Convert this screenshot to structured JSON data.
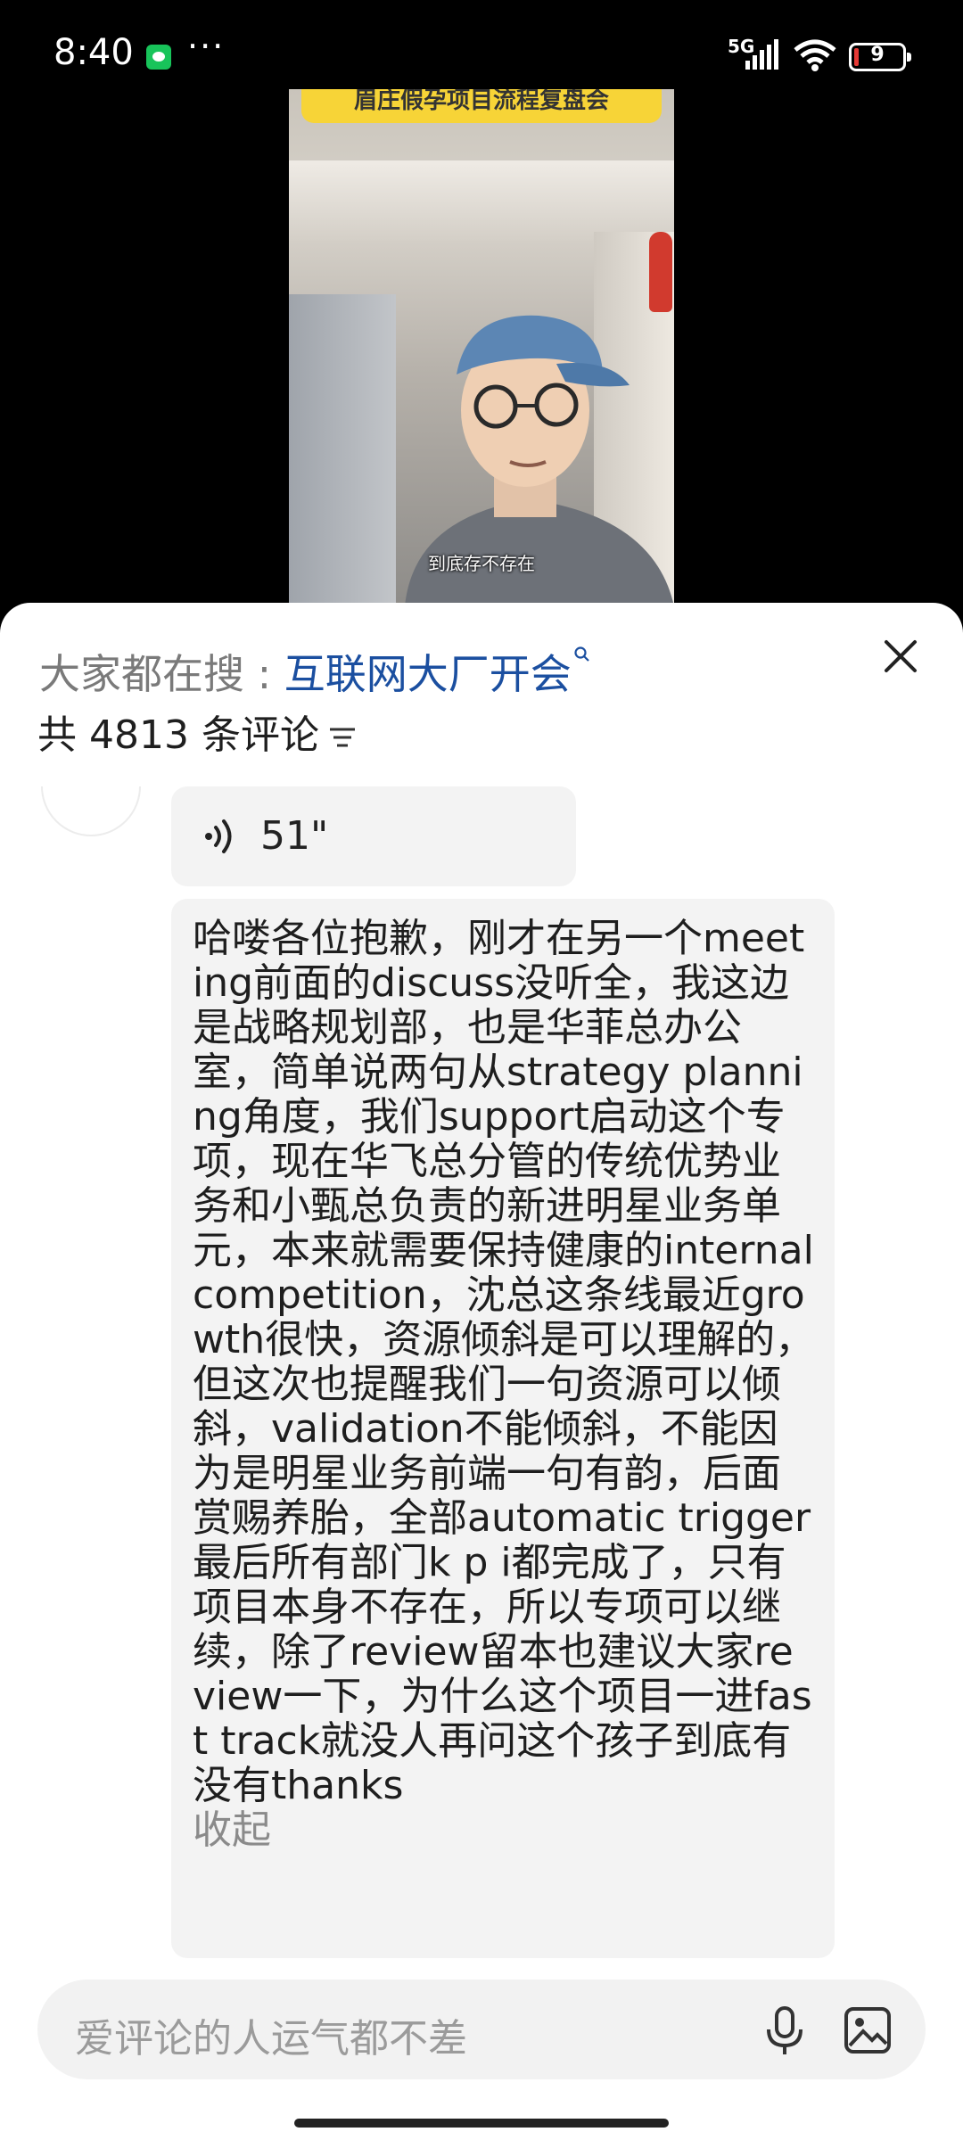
{
  "status_bar": {
    "time": "8:40",
    "more": "···",
    "network": "5G",
    "battery_level": "9"
  },
  "video": {
    "banner_text": "眉庄假孕项目流程复盘会",
    "subtitle": "到底存不存在"
  },
  "comment_panel": {
    "search_prefix": "大家都在搜 : ",
    "search_term": "互联网大厂开会",
    "count_text": "共 4813 条评论",
    "voice_duration": "51\"",
    "comment_text": "哈喽各位抱歉，刚才在另一个meeting前面的discuss没听全，我这边是战略规划部，也是华菲总办公室，简单说两句从strategy planning角度，我们support启动这个专项，现在华飞总分管的传统优势业务和小甄总负责的新进明星业务单元，本来就需要保持健康的internal competition，沈总这条线最近growth很快，资源倾斜是可以理解的，但这次也提醒我们一句资源可以倾斜，validation不能倾斜，不能因为是明星业务前端一句有韵，后面赏赐养胎，全部automatic trigger最后所有部门k p i都完成了，只有项目本身不存在，所以专项可以继续，除了review留本也建议大家review一下，为什么这个项目一进fast track就没人再问这个孩子到底有没有thanks",
    "collapse_label": "收起",
    "input_placeholder": "爱评论的人运气都不差"
  },
  "icons": {
    "close": "close-icon",
    "search": "search-icon",
    "filter": "filter-icon",
    "voice": "voice-wave-icon",
    "mic": "mic-icon",
    "image": "image-icon"
  },
  "colors": {
    "search_term": "#1b4fa0",
    "banner": "#f7d437",
    "bubble": "#f3f3f3"
  }
}
